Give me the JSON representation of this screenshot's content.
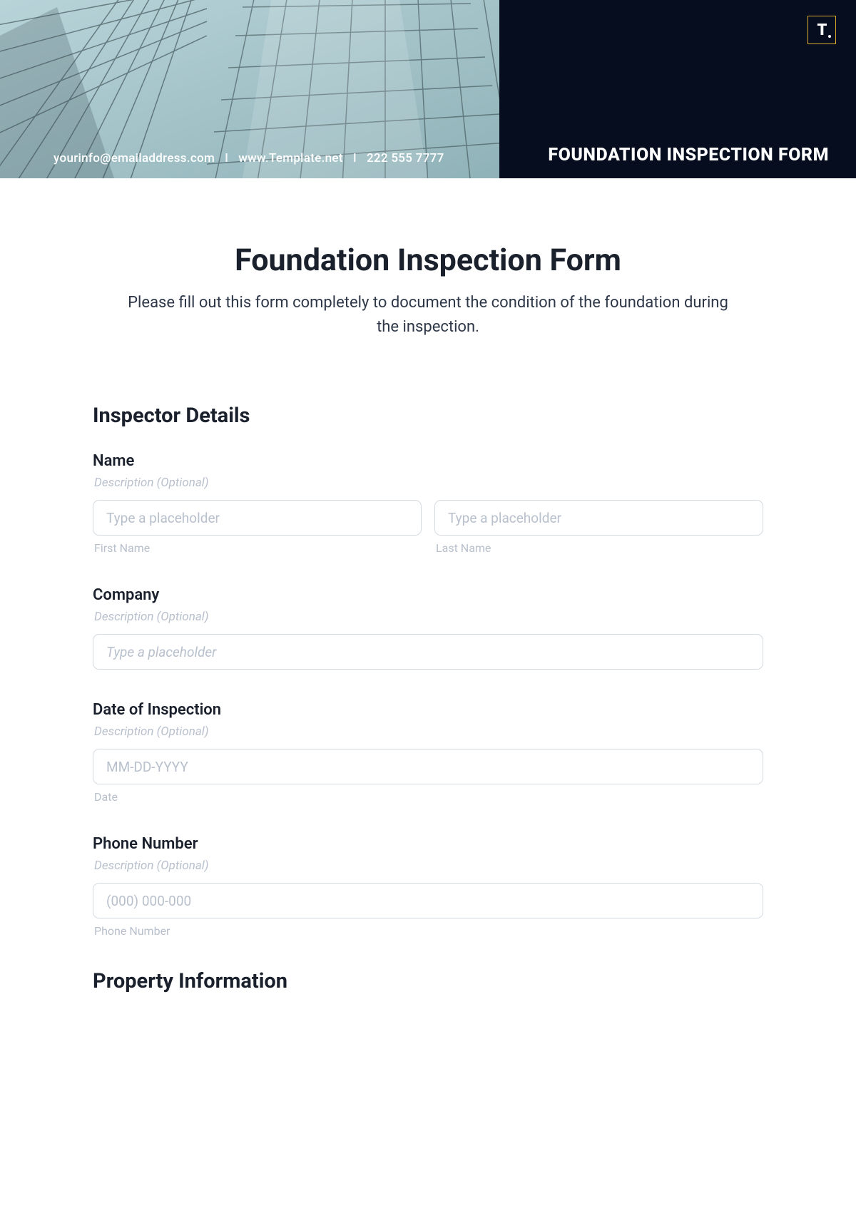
{
  "hero": {
    "contact": {
      "email": "yourinfo@emailaddress.com",
      "website": "www.Template.net",
      "phone": "222 555 7777"
    },
    "title": "FOUNDATION INSPECTION FORM",
    "logo_text": "T."
  },
  "main": {
    "title": "Foundation Inspection Form",
    "subtitle": "Please fill out this form completely to document the condition of the foundation during the inspection."
  },
  "sections": {
    "inspector": {
      "heading": "Inspector Details",
      "fields": {
        "name": {
          "label": "Name",
          "desc": "Description (Optional)",
          "first_placeholder": "Type a placeholder",
          "first_sub": "First Name",
          "last_placeholder": "Type a placeholder",
          "last_sub": "Last Name"
        },
        "company": {
          "label": "Company",
          "desc": "Description (Optional)",
          "placeholder": "Type a placeholder"
        },
        "date": {
          "label": "Date of Inspection",
          "desc": "Description (Optional)",
          "placeholder": "MM-DD-YYYY",
          "sub": "Date"
        },
        "phoneNum": {
          "label": "Phone Number",
          "desc": "Description (Optional)",
          "placeholder": "(000) 000-000",
          "sub": "Phone Number"
        }
      }
    },
    "property": {
      "heading": "Property Information"
    }
  }
}
